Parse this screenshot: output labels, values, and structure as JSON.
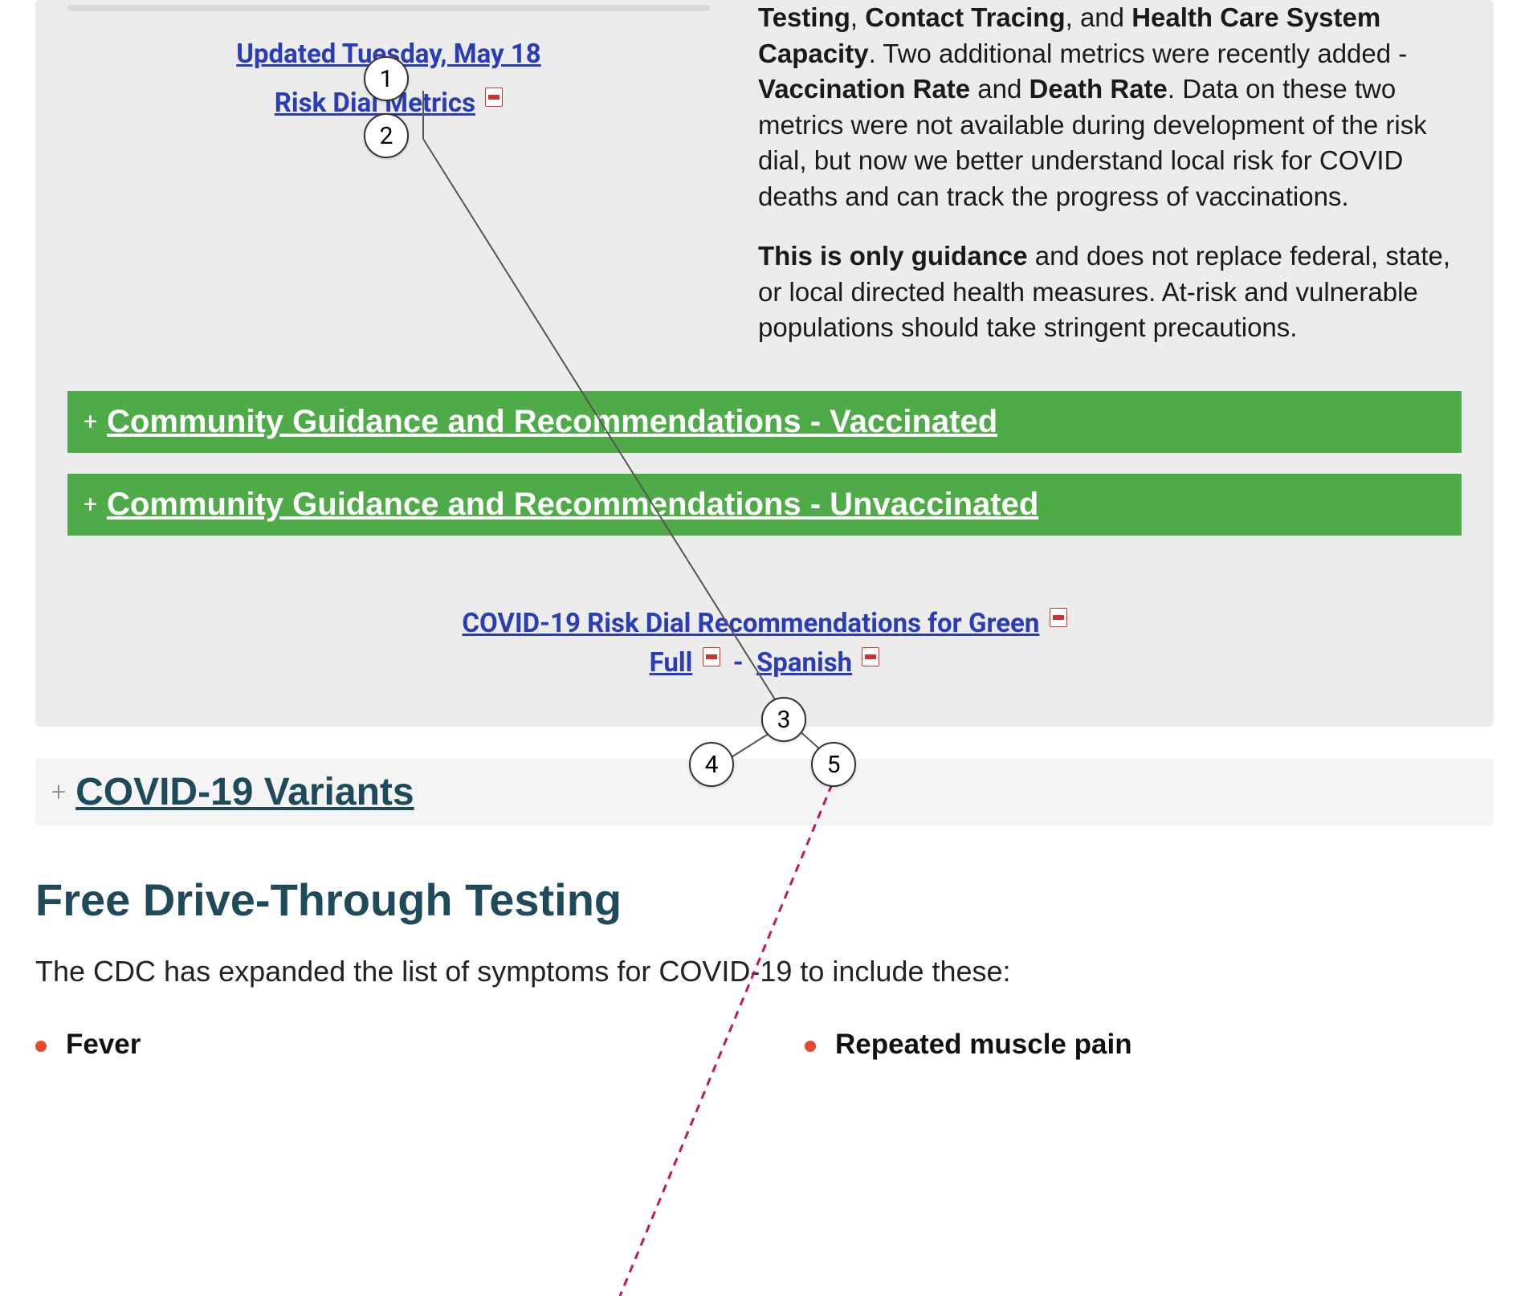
{
  "left_links": {
    "updated_label": "Updated Tuesday, May 18",
    "risk_metrics_label": "Risk Dial Metrics"
  },
  "paragraph": {
    "p1_pre": "",
    "p1_strong1": "Testing",
    "p1_mid1": ", ",
    "p1_strong2": "Contact Tracing",
    "p1_mid2": ", and ",
    "p1_strong3": "Health Care System Capacity",
    "p1_mid3": ". Two additional metrics were recently added - ",
    "p1_strong4": "Vaccination Rate",
    "p1_mid4": " and ",
    "p1_strong5": "Death Rate",
    "p1_tail": ". Data on these two metrics were not available during development of the risk dial, but now we better understand local risk for COVID deaths and can track the progress of vaccinations.",
    "p2_strong": "This is only guidance",
    "p2_tail": " and does not replace federal, state, or local directed health measures. At-risk and vulnerable populations should take stringent precautions."
  },
  "accordion_vaccinated": "Community Guidance and Recommendations - Vaccinated",
  "accordion_unvaccinated": "Community Guidance and Recommendations - Unvaccinated",
  "green_link_main": "COVID-19 Risk Dial Recommendations for Green",
  "green_link_full": "Full",
  "green_link_spanish": "Spanish",
  "variants_title": "COVID-19 Variants",
  "testing_heading": "Free Drive-Through Testing",
  "testing_intro": "The CDC has expanded the list of symptoms for COVID-19 to include these:",
  "symptoms_left": [
    "Fever"
  ],
  "symptoms_right": [
    "Repeated muscle pain"
  ],
  "markers": [
    "1",
    "2",
    "3",
    "4",
    "5"
  ]
}
